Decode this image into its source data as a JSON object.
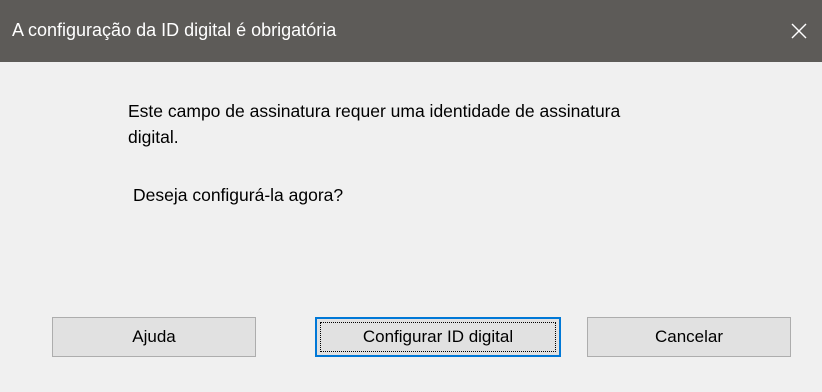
{
  "dialog": {
    "title": "A configuração da ID digital é obrigatória",
    "message_line1": "Este campo de assinatura requer uma identidade de assinatura",
    "message_line2": "digital.",
    "question": "Deseja configurá-la agora?",
    "close_icon": "close-icon"
  },
  "buttons": {
    "help": "Ajuda",
    "configure": "Configurar ID digital",
    "cancel": "Cancelar"
  },
  "colors": {
    "titlebar": "#5d5b58",
    "background": "#f0f0f0",
    "button_face": "#e1e1e1",
    "focus_accent": "#0078d7"
  }
}
